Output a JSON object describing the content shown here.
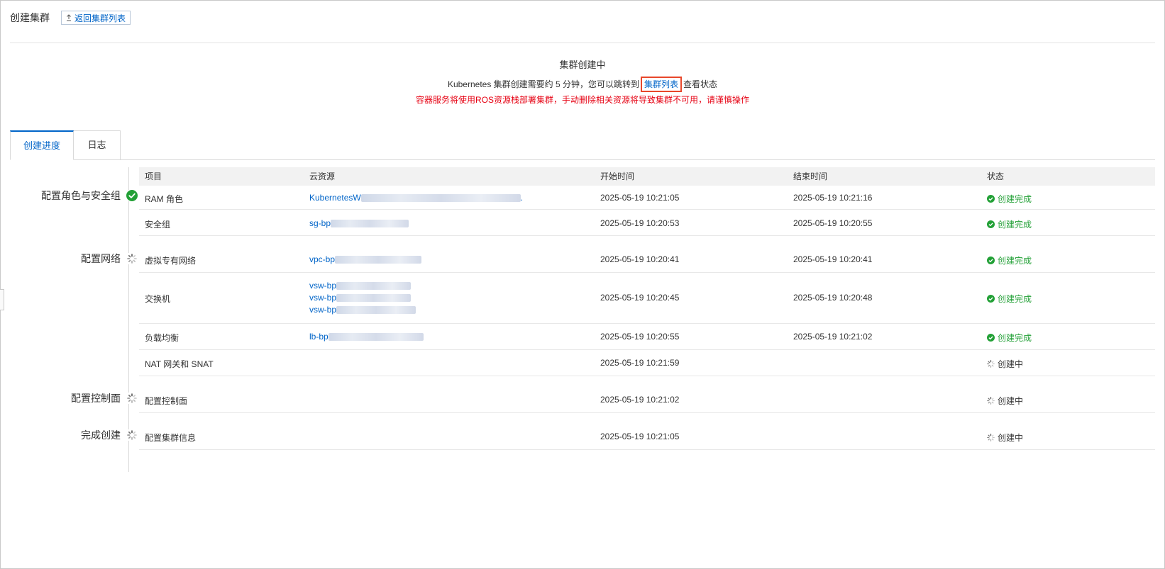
{
  "header": {
    "title": "创建集群",
    "back_label": "返回集群列表"
  },
  "status": {
    "title": "集群创建中",
    "desc_prefix": "Kubernetes 集群创建需要约 5 分钟，您可以跳转到",
    "desc_link": "集群列表",
    "desc_suffix": "查看状态",
    "warning": "容器服务将使用ROS资源栈部署集群，手动删除相关资源将导致集群不可用，请谨慎操作"
  },
  "tabs": [
    "创建进度",
    "日志"
  ],
  "stages": [
    {
      "label": "配置角色与安全组",
      "state": "done"
    },
    {
      "label": "配置网络",
      "state": "loading"
    },
    {
      "label": "配置控制面",
      "state": "loading"
    },
    {
      "label": "完成创建",
      "state": "loading"
    }
  ],
  "table": {
    "headers": [
      "项目",
      "云资源",
      "开始时间",
      "结束时间",
      "状态"
    ],
    "rows": [
      {
        "item": "RAM 角色",
        "resources": [
          "KubernetesW"
        ],
        "start": "2025-05-19 10:21:05",
        "end": "2025-05-19 10:21:16",
        "status": "创建完成",
        "state": "done"
      },
      {
        "item": "安全组",
        "resources": [
          "sg-bp"
        ],
        "start": "2025-05-19 10:20:53",
        "end": "2025-05-19 10:20:55",
        "status": "创建完成",
        "state": "done"
      },
      {
        "item": "虚拟专有网络",
        "resources": [
          "vpc-bp"
        ],
        "start": "2025-05-19 10:20:41",
        "end": "2025-05-19 10:20:41",
        "status": "创建完成",
        "state": "done"
      },
      {
        "item": "交换机",
        "resources": [
          "vsw-bp",
          "vsw-bp",
          "vsw-bp"
        ],
        "start": "2025-05-19 10:20:45",
        "end": "2025-05-19 10:20:48",
        "status": "创建完成",
        "state": "done"
      },
      {
        "item": "负载均衡",
        "resources": [
          "lb-bp"
        ],
        "start": "2025-05-19 10:20:55",
        "end": "2025-05-19 10:21:02",
        "status": "创建完成",
        "state": "done"
      },
      {
        "item": "NAT 网关和 SNAT",
        "resources": [],
        "start": "2025-05-19 10:21:59",
        "end": "",
        "status": "创建中",
        "state": "loading"
      },
      {
        "item": "配置控制面",
        "resources": [],
        "start": "2025-05-19 10:21:02",
        "end": "",
        "status": "创建中",
        "state": "loading"
      },
      {
        "item": "配置集群信息",
        "resources": [],
        "start": "2025-05-19 10:21:05",
        "end": "",
        "status": "创建中",
        "state": "loading"
      }
    ]
  },
  "colors": {
    "accent": "#0064c8",
    "success": "#22a036",
    "warning": "#e60012",
    "highlight_box": "#e8472b"
  }
}
